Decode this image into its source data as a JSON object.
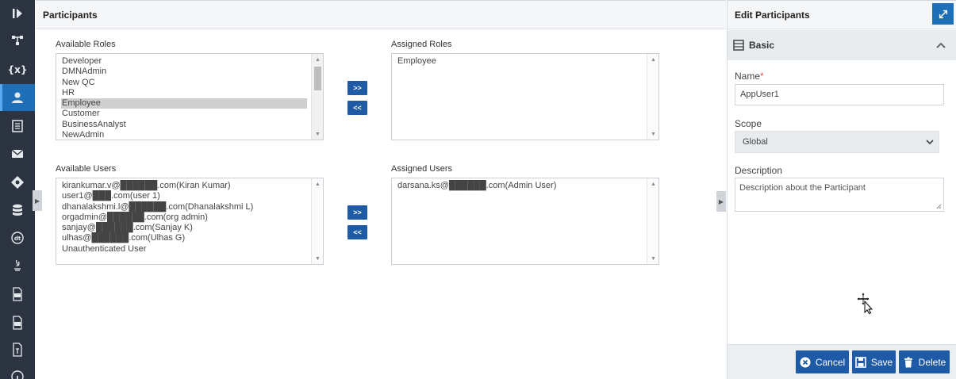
{
  "main": {
    "title": "Participants",
    "available_roles": {
      "label": "Available Roles",
      "items": [
        "Developer",
        "DMNAdmin",
        "New QC",
        "HR",
        "Employee",
        "Customer",
        "BusinessAnalyst",
        "NewAdmin"
      ],
      "selected": "Employee"
    },
    "assigned_roles": {
      "label": "Assigned Roles",
      "items": [
        "Employee"
      ]
    },
    "available_users": {
      "label": "Available Users",
      "items": [
        "kirankumar.v@██████.com(Kiran Kumar)",
        "user1@███.com(user 1)",
        "dhanalakshmi.l@██████.com(Dhanalakshmi L)",
        "orgadmin@██████.com(org admin)",
        "sanjay@██████.com(Sanjay K)",
        "ulhas@██████.com(Ulhas G)",
        "Unauthenticated User"
      ]
    },
    "assigned_users": {
      "label": "Assigned Users",
      "items": [
        "darsana.ks@██████.com(Admin User)"
      ]
    },
    "move_right_label": ">>",
    "move_left_label": "<<"
  },
  "edit_panel": {
    "title": "Edit Participants",
    "section_title": "Basic",
    "name_label": "Name",
    "required_mark": "*",
    "name_value": "AppUser1",
    "scope_label": "Scope",
    "scope_value": "Global",
    "description_label": "Description",
    "description_value": "Description about the Participant",
    "buttons": {
      "cancel": "Cancel",
      "save": "Save",
      "delete": "Delete"
    }
  },
  "sidebar": {
    "items": [
      {
        "name": "play-icon"
      },
      {
        "name": "process-icon"
      },
      {
        "name": "variables-icon",
        "text": "{x}"
      },
      {
        "name": "participants-icon",
        "active": true
      },
      {
        "name": "document-icon"
      },
      {
        "name": "mail-icon"
      },
      {
        "name": "gateway-icon"
      },
      {
        "name": "database-icon"
      },
      {
        "name": "dt-icon"
      },
      {
        "name": "java-icon"
      },
      {
        "name": "js-file-icon"
      },
      {
        "name": "css-file-icon"
      },
      {
        "name": "text-file-icon"
      },
      {
        "name": "info-icon"
      }
    ]
  },
  "colors": {
    "sidebar_bg": "#2b3440",
    "active_blue": "#1f6fb8",
    "button_blue": "#1e5aa6"
  }
}
